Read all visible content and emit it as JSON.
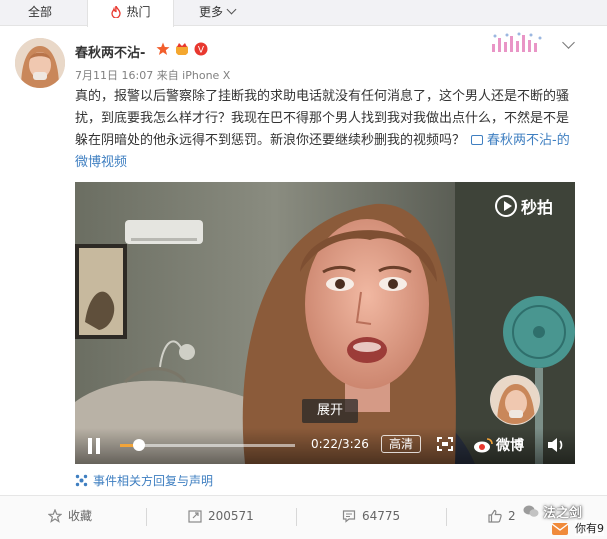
{
  "tabs": {
    "all": "全部",
    "hot": "热门",
    "more": "更多"
  },
  "post": {
    "username": "春秋两不沾-",
    "meta": "7月11日 16:07 来自 iPhone X",
    "text": "真的，报警以后警察除了挂断我的求助电话就没有任何消息了，这个男人还是不断的骚扰，到底要我怎么样才行？我现在巴不得那个男人找到我对我做出点什么，不然是不是躲在阴暗处的他永远得不到惩罚。新浪你还要继续秒删我的视频吗？",
    "video_link": "春秋两不沾-的微博视频",
    "event_link": "事件相关方回复与声明"
  },
  "video": {
    "watermark": "秒拍",
    "expand_label": "展开",
    "time": "0:22/3:26",
    "progress": 0.107,
    "quality": "高清",
    "weibo_label": "微博"
  },
  "actions": {
    "favorite": "收藏",
    "repost": "200571",
    "comment": "64775",
    "like": "2"
  },
  "overlay": {
    "brand": "法之剑",
    "sub": "你有9"
  },
  "colors": {
    "accent_orange": "#f2a43a",
    "link_blue": "#3f7fc1",
    "hot_red": "#e8382f"
  }
}
